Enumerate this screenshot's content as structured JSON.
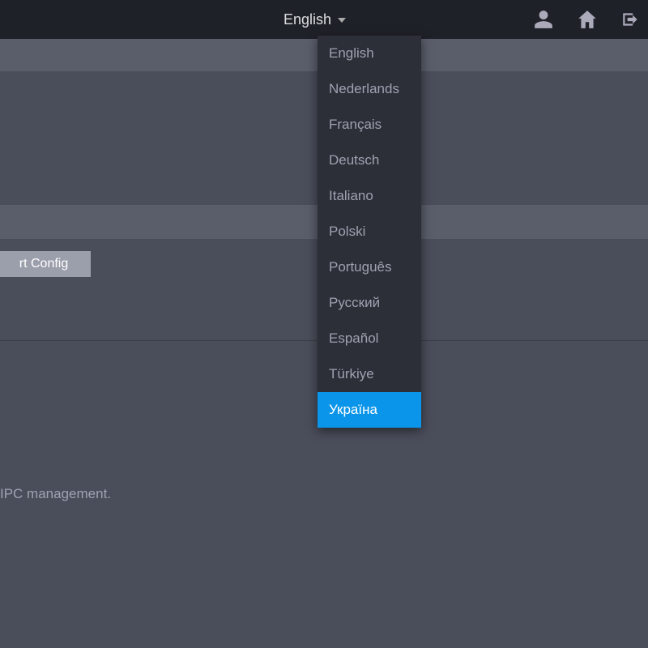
{
  "header": {
    "language_current": "English"
  },
  "dropdown": {
    "items": [
      {
        "label": "English"
      },
      {
        "label": "Nederlands"
      },
      {
        "label": "Français"
      },
      {
        "label": "Deutsch"
      },
      {
        "label": "Italiano"
      },
      {
        "label": "Polski"
      },
      {
        "label": "Português"
      },
      {
        "label": "Русский"
      },
      {
        "label": "Español"
      },
      {
        "label": "Türkiye"
      },
      {
        "label": "Україна"
      }
    ],
    "active_index": 10
  },
  "buttons": {
    "config": "rt Config"
  },
  "hint": {
    "text": "IPC management."
  }
}
